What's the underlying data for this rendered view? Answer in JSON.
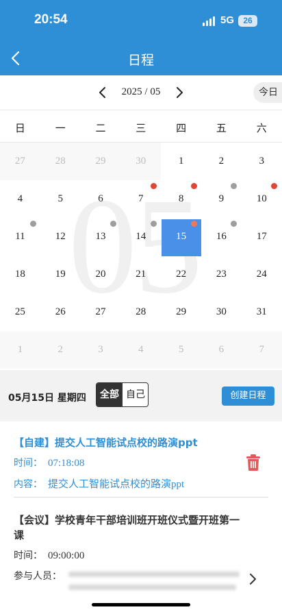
{
  "status_bar": {
    "time": "20:54",
    "network": "5G",
    "battery": "26"
  },
  "header": {
    "title": "日程",
    "back_icon": "chevron-left-icon"
  },
  "calendar": {
    "month_label": "2025 / 05",
    "today_button": "今日",
    "watermark": "05",
    "weekdays": [
      "日",
      "一",
      "二",
      "三",
      "四",
      "五",
      "六"
    ],
    "weeks": [
      [
        "27",
        "28",
        "29",
        "30",
        "1",
        "2",
        "3"
      ],
      [
        "4",
        "5",
        "6",
        "7",
        "8",
        "9",
        "10"
      ],
      [
        "11",
        "12",
        "13",
        "14",
        "15",
        "16",
        "17"
      ],
      [
        "18",
        "19",
        "20",
        "21",
        "22",
        "23",
        "24"
      ],
      [
        "25",
        "26",
        "27",
        "28",
        "29",
        "30",
        "31"
      ],
      [
        "1",
        "2",
        "3",
        "4",
        "5",
        "6",
        "7"
      ]
    ],
    "selected_day": "15",
    "colors": {
      "accent": "#2f8fd6",
      "selected": "#4a8fe8",
      "dot_red": "#e0453a",
      "dot_gray": "#9e9e9e",
      "dot_orange": "#f0785a"
    }
  },
  "day_panel": {
    "date_label": "05月15日 星期四",
    "filter_all": "全部",
    "filter_self": "自己",
    "create_button": "创建日程"
  },
  "events": [
    {
      "title": "【自建】提交人工智能试点校的路演ppt",
      "time_label": "时间：",
      "time": "07:18:08",
      "content_label": "内容：",
      "content": "提交人工智能试点校的路演ppt",
      "delete_icon": "trash-icon"
    },
    {
      "title": "【会议】学校青年干部培训班开班仪式暨开班第一课",
      "time_label": "时间：",
      "time": "09:00:00",
      "participants_label": "参与人员：",
      "more_icon": "chevron-right-icon"
    }
  ]
}
